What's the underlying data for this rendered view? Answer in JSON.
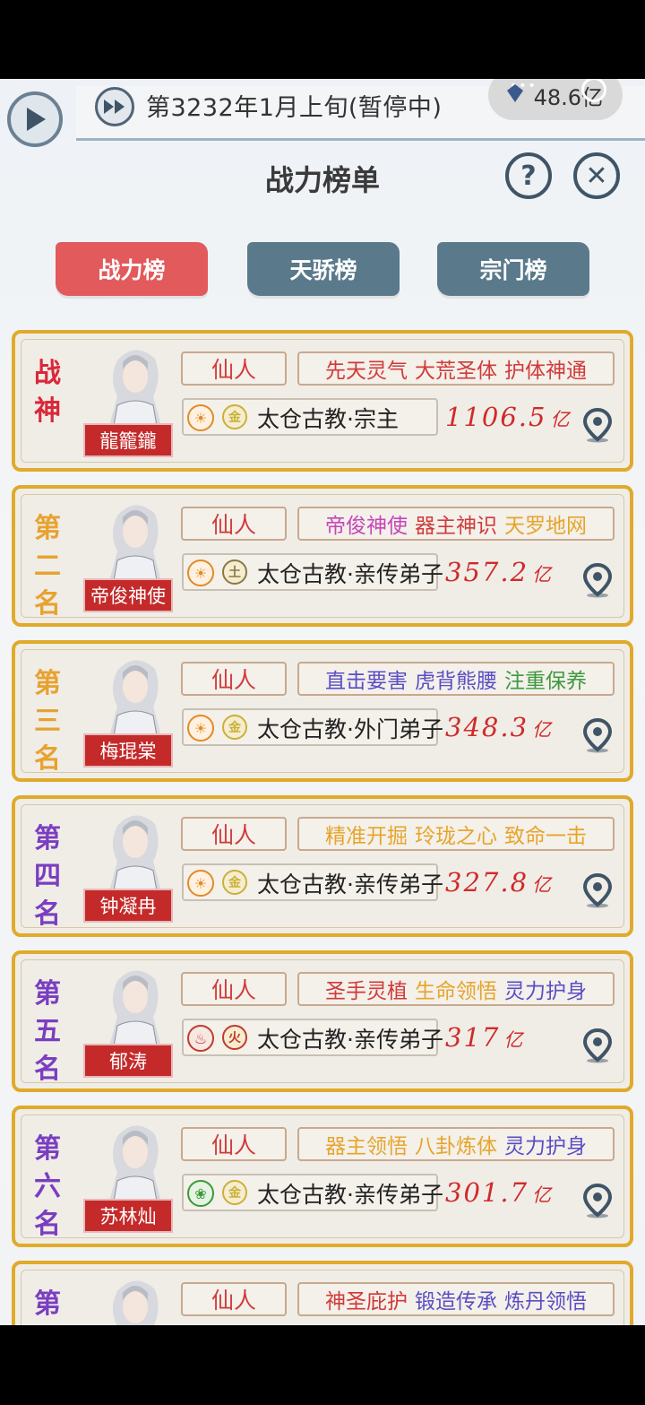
{
  "status": {
    "date": "第3232年1月上旬(暂停中)",
    "currency": "48.6亿"
  },
  "header": {
    "title": "战力榜单",
    "help": "?",
    "close": "✕"
  },
  "tabs": [
    {
      "label": "战力榜"
    },
    {
      "label": "天骄榜"
    },
    {
      "label": "宗门榜"
    }
  ],
  "colors": {
    "active_tab": "#e25a5c",
    "inactive_tab": "#5a7a8c",
    "card_border": "#e0aa2a"
  },
  "ranks": [
    {
      "rank_chars": [
        "战",
        "神"
      ],
      "rank_color": "#d9283a",
      "name": "龍籠鑨",
      "realm": "仙人",
      "skills": [
        {
          "text": "先天灵气",
          "color": "#d03a3a"
        },
        {
          "text": "大荒圣体",
          "color": "#d03a3a"
        },
        {
          "text": "护体神通",
          "color": "#d03a3a"
        }
      ],
      "icon1": "sun-icon",
      "element": "金",
      "element_color": "#c9b13a",
      "sect": "太仓古教·宗主",
      "power": "1106.5",
      "unit": "亿"
    },
    {
      "rank_chars": [
        "第",
        "二",
        "名"
      ],
      "rank_color": "#e7a230",
      "name": "帝俊神使",
      "realm": "仙人",
      "skills": [
        {
          "text": "帝俊神使",
          "color": "#c546b8"
        },
        {
          "text": "器主神识",
          "color": "#d03a3a"
        },
        {
          "text": "天罗地网",
          "color": "#e6a52a"
        }
      ],
      "icon1": "sun-icon",
      "element": "土",
      "element_color": "#8a7a48",
      "sect": "太仓古教·亲传弟子",
      "power": "357.2",
      "unit": "亿"
    },
    {
      "rank_chars": [
        "第",
        "三",
        "名"
      ],
      "rank_color": "#e7a230",
      "name": "梅琨棠",
      "realm": "仙人",
      "skills": [
        {
          "text": "直击要害",
          "color": "#5a4ec4"
        },
        {
          "text": "虎背熊腰",
          "color": "#5a4ec4"
        },
        {
          "text": "注重保养",
          "color": "#3e9a3e"
        }
      ],
      "icon1": "sun-icon",
      "element": "金",
      "element_color": "#c9b13a",
      "sect": "太仓古教·外门弟子",
      "power": "348.3",
      "unit": "亿"
    },
    {
      "rank_chars": [
        "第",
        "四",
        "名"
      ],
      "rank_color": "#7a3ec0",
      "name": "钟凝冉",
      "realm": "仙人",
      "skills": [
        {
          "text": "精准开掘",
          "color": "#e6a52a"
        },
        {
          "text": "玲珑之心",
          "color": "#e6a52a"
        },
        {
          "text": "致命一击",
          "color": "#e6a52a"
        }
      ],
      "icon1": "sun-icon",
      "element": "金",
      "element_color": "#c9b13a",
      "sect": "太仓古教·亲传弟子",
      "power": "327.8",
      "unit": "亿"
    },
    {
      "rank_chars": [
        "第",
        "五",
        "名"
      ],
      "rank_color": "#7a3ec0",
      "name": "郁涛",
      "realm": "仙人",
      "skills": [
        {
          "text": "圣手灵植",
          "color": "#d03a3a"
        },
        {
          "text": "生命领悟",
          "color": "#e6a52a"
        },
        {
          "text": "灵力护身",
          "color": "#5a4ec4"
        }
      ],
      "icon1": "fire-ring-icon",
      "element": "火",
      "element_color": "#c23a2a",
      "sect": "太仓古教·亲传弟子",
      "power": "317",
      "unit": "亿"
    },
    {
      "rank_chars": [
        "第",
        "六",
        "名"
      ],
      "rank_color": "#7a3ec0",
      "name": "苏林灿",
      "realm": "仙人",
      "skills": [
        {
          "text": "器主领悟",
          "color": "#e6a52a"
        },
        {
          "text": "八卦炼体",
          "color": "#e6a52a"
        },
        {
          "text": "灵力护身",
          "color": "#5a4ec4"
        }
      ],
      "icon1": "leaf-ring-icon",
      "element": "金",
      "element_color": "#c9b13a",
      "sect": "太仓古教·亲传弟子",
      "power": "301.7",
      "unit": "亿"
    },
    {
      "rank_chars": [
        "第"
      ],
      "rank_color": "#7a3ec0",
      "name": "",
      "realm": "仙人",
      "skills": [
        {
          "text": "神圣庇护",
          "color": "#d03a3a"
        },
        {
          "text": "锻造传承",
          "color": "#5a4ec4"
        },
        {
          "text": "炼丹领悟",
          "color": "#5a4ec4"
        }
      ],
      "icon1": "",
      "element": "",
      "element_color": "#c9b13a",
      "sect": "",
      "power": "",
      "unit": ""
    }
  ]
}
